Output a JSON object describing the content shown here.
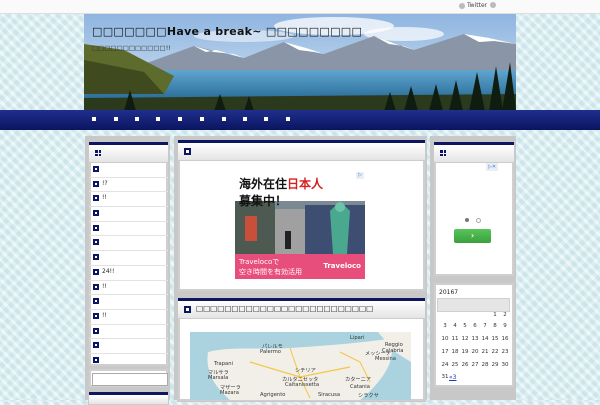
{
  "topbar": {
    "twitter_label": "Twitter"
  },
  "header": {
    "title": "□□□□□□□Have a break~ □□□□□□□□□",
    "subtitle": "□□□□□□□□□□□□!!"
  },
  "colors": {
    "nav": "#0b1560",
    "accent": "#0b1560",
    "ad_pink": "#e84e7b",
    "ad_red": "#d61f1f",
    "button_green": "#3ba03d",
    "link": "#1a3cb8"
  },
  "nav": {
    "item_count_icons": [
      "nav-bullet",
      "nav-bullet",
      "nav-bullet",
      "nav-bullet",
      "nav-bullet",
      "nav-bullet",
      "nav-bullet",
      "nav-bullet",
      "nav-bullet",
      "nav-bullet"
    ]
  },
  "left_sidebar": {
    "items": [
      {
        "label": ""
      },
      {
        "label": "!?"
      },
      {
        "label": "!!"
      },
      {
        "label": ""
      },
      {
        "label": ""
      },
      {
        "label": ""
      },
      {
        "label": ""
      },
      {
        "label": "24!!"
      },
      {
        "label": "!!"
      },
      {
        "label": ""
      },
      {
        "label": "!!"
      },
      {
        "label": ""
      },
      {
        "label": ""
      },
      {
        "label": ""
      }
    ]
  },
  "ad": {
    "line1_a": "海外在住",
    "line1_b": "日本人",
    "line2": "募集中！",
    "bottom1": "Travelocoで",
    "bottom2": "空き時間を有効活用",
    "logo": "Traveloco",
    "close_label": "x"
  },
  "post": {
    "title": "□□□□□□□□□□□□□□□□□□□□□□□□□"
  },
  "map": {
    "labels": [
      {
        "text": "パレルモ",
        "k": "a"
      },
      {
        "text": "Palermo",
        "k": "b"
      },
      {
        "text": "Trapani",
        "k": "c"
      },
      {
        "text": "マルサラ",
        "k": "d"
      },
      {
        "text": "Marsala",
        "k": "e"
      },
      {
        "text": "シチリア",
        "k": "f"
      },
      {
        "text": "Caltanissetta",
        "k": "g"
      },
      {
        "text": "Catania",
        "k": "h"
      },
      {
        "text": "カターニア",
        "k": "i"
      },
      {
        "text": "カルタニセッタ",
        "k": "j"
      },
      {
        "text": "メッシーナ",
        "k": "k"
      },
      {
        "text": "Messina",
        "k": "l"
      },
      {
        "text": "Reggio",
        "k": "m"
      },
      {
        "text": "Calabria",
        "k": "n"
      },
      {
        "text": "Agrigento",
        "k": "o"
      },
      {
        "text": "マザーラ",
        "k": "p"
      },
      {
        "text": "Mazara",
        "k": "q"
      },
      {
        "text": "シラクサ",
        "k": "r"
      },
      {
        "text": "Siracusa",
        "k": "s"
      },
      {
        "text": "Lipari",
        "k": "t"
      }
    ]
  },
  "right_sidebar": {
    "next_label": "›",
    "calendar": {
      "title": "20167",
      "rows": [
        [
          "",
          "",
          "",
          "",
          "",
          "1",
          "2"
        ],
        [
          "3",
          "4",
          "5",
          "6",
          "7",
          "8",
          "9"
        ],
        [
          "10",
          "11",
          "12",
          "13",
          "14",
          "15",
          "16"
        ],
        [
          "17",
          "18",
          "19",
          "20",
          "21",
          "22",
          "23"
        ],
        [
          "24",
          "25",
          "26",
          "27",
          "28",
          "29",
          "30"
        ],
        [
          "31",
          "",
          "",
          "",
          "",
          "",
          ""
        ]
      ],
      "prev_label": "«3"
    }
  }
}
